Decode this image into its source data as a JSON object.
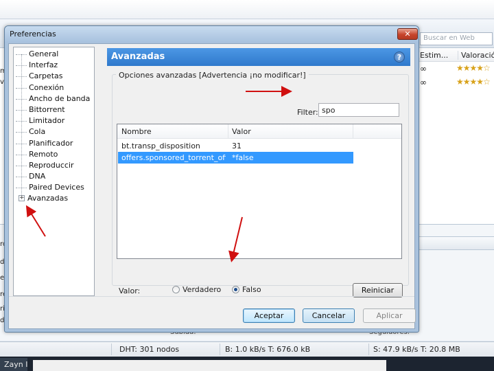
{
  "background": {
    "search_placeholder": "Buscar en Web",
    "columns": [
      "Estim...",
      "Valoración"
    ],
    "rows": [
      {
        "eta": "∞",
        "rating": "★★★★☆"
      },
      {
        "eta": "∞",
        "rating": "★★★★☆"
      }
    ],
    "sub_labels": [
      "Subida:",
      "Seguidores:"
    ],
    "left_letters": [
      "m",
      "v",
      "ro",
      "d",
      "e",
      "re",
      "ri",
      "d"
    ]
  },
  "statusbar": {
    "dht": "DHT: 301 nodos",
    "download": "B: 1.0 kB/s T: 676.0 kB",
    "upload": "S: 47.9 kB/s T: 20.8 MB"
  },
  "taskbar": {
    "task_label": "Zayn I"
  },
  "dialog": {
    "title": "Preferencias",
    "close_glyph": "✕",
    "tree": [
      "General",
      "Interfaz",
      "Carpetas",
      "Conexión",
      "Ancho de banda",
      "Bittorrent",
      "Limitador",
      "Cola",
      "Planificador",
      "Remoto",
      "Reproduccir",
      "DNA",
      "Paired Devices",
      "Avanzadas"
    ],
    "expander_glyph": "+",
    "panel_title": "Avanzadas",
    "help_glyph": "?",
    "group_title": "Opciones avanzadas [Advertencia ¡no modificar!]",
    "filter_label": "Filter:",
    "filter_value": "spo",
    "grid": {
      "headers": [
        "Nombre",
        "Valor"
      ],
      "rows": [
        {
          "name": "bt.transp_disposition",
          "value": "31",
          "selected": false
        },
        {
          "name": "offers.sponsored_torrent_offer...",
          "value": "*false",
          "selected": true
        }
      ]
    },
    "valor_label": "Valor:",
    "radio_true": "Verdadero",
    "radio_false": "Falso",
    "radio_selected": "false",
    "reset_button": "Reiniciar",
    "ok_button": "Aceptar",
    "cancel_button": "Cancelar",
    "apply_button": "Aplicar"
  },
  "colors": {
    "header_blue": "#3a86d8",
    "selection": "#3399ff",
    "annotation": "#d01010"
  }
}
